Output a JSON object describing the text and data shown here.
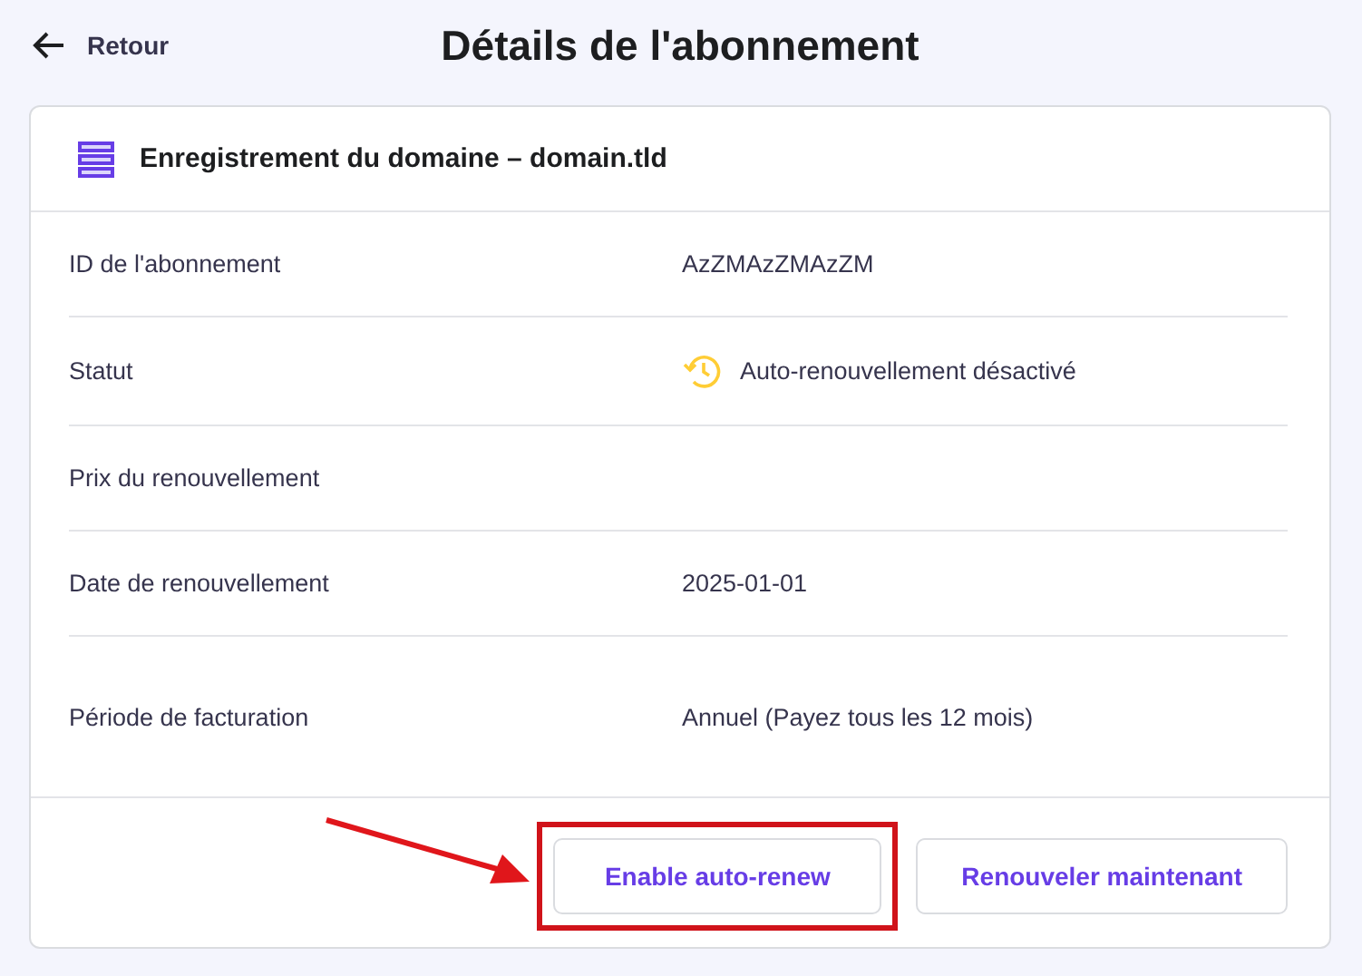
{
  "header": {
    "back_label": "Retour",
    "title": "Détails de l'abonnement"
  },
  "card": {
    "title": "Enregistrement du domaine – domain.tld",
    "rows": [
      {
        "kind": "text",
        "label": "ID de l'abonnement",
        "value": "AzZMAzZMAzZM"
      },
      {
        "kind": "status",
        "label": "Statut",
        "value": "Auto-renouvellement désactivé"
      },
      {
        "kind": "text",
        "label": "Prix du renouvellement"
      },
      {
        "kind": "text",
        "label": "Date de renouvellement",
        "value": "2025-01-01"
      },
      {
        "kind": "text",
        "label": "Période de facturation",
        "value": "Annuel (Payez tous les 12 mois)"
      }
    ],
    "buttons": [
      {
        "label": "Enable auto-renew",
        "highlighted": true
      },
      {
        "label": "Renouveler maintenant",
        "highlighted": false
      }
    ]
  }
}
